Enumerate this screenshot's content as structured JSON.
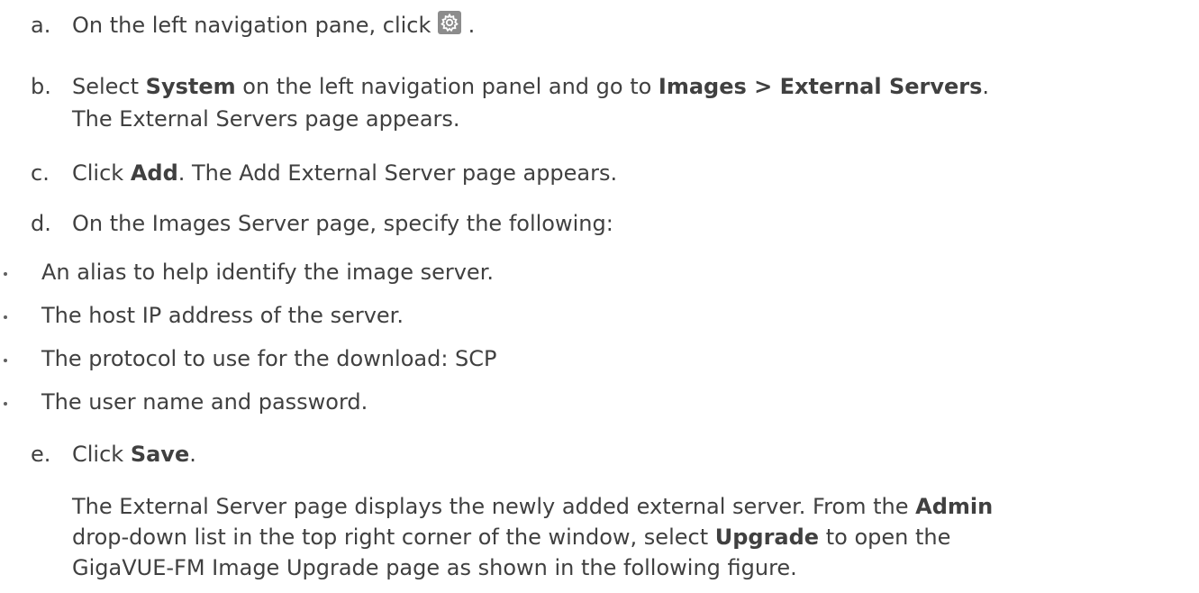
{
  "steps": [
    {
      "marker": "a.",
      "line1_pre": "On the left navigation pane, click",
      "line1_post": "."
    },
    {
      "marker": "b.",
      "pre": "Select ",
      "b1": "System",
      "mid": " on the left navigation panel and go to ",
      "b2": "Images > External Servers",
      "post": ".",
      "line2": "The External Servers page appears."
    },
    {
      "marker": "c.",
      "pre": "Click ",
      "b1": "Add",
      "post": ". The Add External Server page appears."
    },
    {
      "marker": "d.",
      "text": "On the Images Server page, specify the following:"
    }
  ],
  "bullets": [
    "An alias to help identify the image server.",
    "The host IP address of the server.",
    "The protocol to use for the download: SCP",
    "The user name and password."
  ],
  "step_e": {
    "marker": "e.",
    "pre": "Click ",
    "b1": "Save",
    "post": ".",
    "para_l1_pre": "The External Server page displays the newly added external server. From the ",
    "para_l1_b": "Admin",
    "para_l2_pre": "drop-down list in the top right corner of the window, select ",
    "para_l2_b": "Upgrade",
    "para_l2_post": " to open the",
    "para_l3": "GigaVUE-FM Image Upgrade page as shown in the following figure."
  },
  "icons": {
    "settings": "gear-icon"
  }
}
